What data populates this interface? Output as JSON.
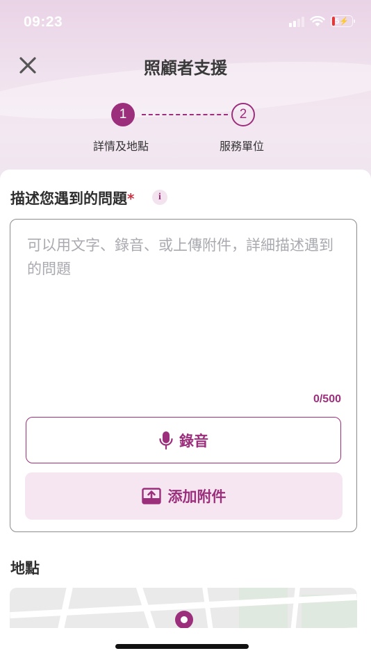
{
  "status_bar": {
    "time": "09:23",
    "battery": "5"
  },
  "header": {
    "title": "照顧者支援",
    "close_icon": "close-icon"
  },
  "stepper": {
    "steps": [
      {
        "number": "1",
        "label": "詳情及地點",
        "active": true
      },
      {
        "number": "2",
        "label": "服務單位",
        "active": false
      }
    ]
  },
  "description": {
    "title": "描述您遇到的問題",
    "required_mark": "*",
    "info_icon": "i",
    "placeholder": "可以用文字、錄音、或上傳附件，詳細描述遇到的問題",
    "counter": "0/500",
    "record_label": "錄音",
    "attach_label": "添加附件"
  },
  "location": {
    "title": "地點"
  },
  "colors": {
    "accent": "#9c2f7c",
    "attach_bg": "#f5e6f1",
    "required": "#cc3344"
  }
}
